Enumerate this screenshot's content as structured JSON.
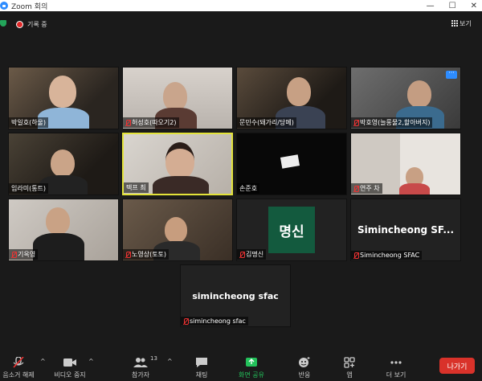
{
  "window": {
    "title": "Zoom 회의"
  },
  "topbar": {
    "recording_label": "기록 중",
    "view_label": "보기"
  },
  "tiles": [
    {
      "name": "박일호(하울)",
      "muted": false
    },
    {
      "name": "허성호(따오기2)",
      "muted": true
    },
    {
      "name": "문민수(돼가리/당메)",
      "muted": false
    },
    {
      "name": "박호영(늘롱물2,할아버지)",
      "muted": true
    },
    {
      "name": "임라미(통트)",
      "muted": false
    },
    {
      "name": "텍프 최",
      "muted": false
    },
    {
      "name": "손준호",
      "muted": false
    },
    {
      "name": "연주 차",
      "muted": true
    },
    {
      "name": "기옥영",
      "muted": true
    },
    {
      "name": "노영상(토토)",
      "muted": true
    },
    {
      "name": "김명신",
      "muted": true
    },
    {
      "name": "Simincheong SFAC",
      "muted": true
    },
    {
      "name": "simincheong sfac",
      "muted": true
    }
  ],
  "cards": {
    "myeongsin_logo": "명신",
    "sfac_big": "Simincheong SF...",
    "sfac_small_big": "simincheong sfac"
  },
  "toolbar": {
    "unmute": "음소거 해제",
    "video": "비디오 중지",
    "participants": "참가자",
    "participants_count": "13",
    "chat": "채팅",
    "share": "화면 공유",
    "reactions": "반응",
    "apps": "앱",
    "more": "더 보기",
    "leave": "나가기"
  },
  "colors": {
    "active_speaker": "#e3e33a",
    "share_green": "#23c25b",
    "leave_red": "#d9322a",
    "brand_blue": "#2d8cff"
  }
}
